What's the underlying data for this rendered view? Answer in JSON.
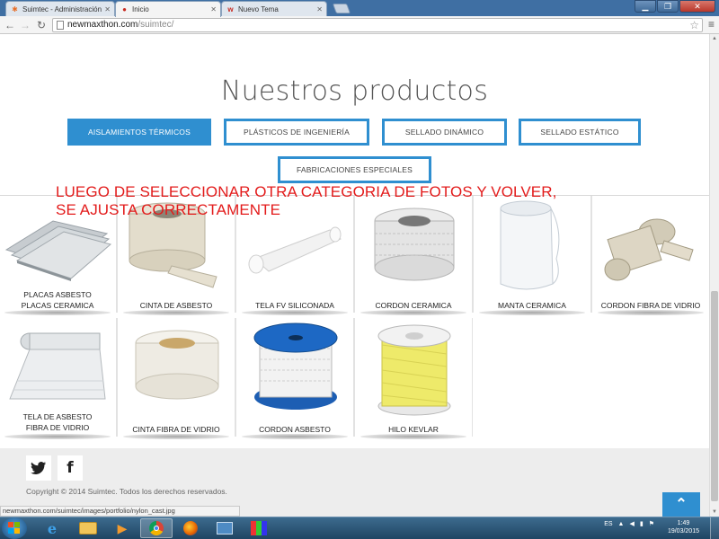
{
  "browser": {
    "tabs": [
      {
        "title": "Suimtec - Administración"
      },
      {
        "title": "Inicio"
      },
      {
        "title": "Nuevo Tema"
      }
    ],
    "url_host": "newmaxthon.com",
    "url_path": "/suimtec/",
    "status_url": "newmaxthon.com/suimtec/images/portfolio/nylon_cast.jpg"
  },
  "page": {
    "title": "Nuestros productos",
    "categories": [
      {
        "label": "AISLAMIENTOS TÉRMICOS",
        "active": true
      },
      {
        "label": "PLÁSTICOS DE INGENIERÍA",
        "active": false
      },
      {
        "label": "SELLADO DINÁMICO",
        "active": false
      },
      {
        "label": "SELLADO ESTÁTICO",
        "active": false
      },
      {
        "label": "FABRICACIONES ESPECIALES",
        "active": false
      }
    ],
    "annotation": {
      "line1": "LUEGO DE SELECCIONAR OTRA CATEGORIA DE FOTOS Y VOLVER,",
      "line2": "SE AJUSTA CORRECTAMENTE"
    },
    "products_row1": [
      {
        "line1": "PLACAS ASBESTO",
        "line2": "PLACAS CERAMICA"
      },
      {
        "line1": "CINTA DE ASBESTO",
        "line2": ""
      },
      {
        "line1": "TELA FV SILICONADA",
        "line2": ""
      },
      {
        "line1": "CORDON CERAMICA",
        "line2": ""
      },
      {
        "line1": "MANTA CERAMICA",
        "line2": ""
      },
      {
        "line1": "CORDON FIBRA DE VIDRIO",
        "line2": ""
      }
    ],
    "products_row2": [
      {
        "line1": "TELA DE ASBESTO",
        "line2": "FIBRA DE VIDRIO"
      },
      {
        "line1": "CINTA FIBRA DE VIDRIO",
        "line2": ""
      },
      {
        "line1": "CORDON ASBESTO",
        "line2": ""
      },
      {
        "line1": "HILO KEVLAR",
        "line2": ""
      }
    ],
    "footer": {
      "copyright": "Copyright © 2014 Suimtec. Todos los derechos reservados."
    }
  },
  "taskbar": {
    "language": "ES",
    "time": "1:49",
    "date": "19/03/2015"
  },
  "colors": {
    "accent": "#2f8fd0",
    "annotation": "#e31b1b"
  }
}
